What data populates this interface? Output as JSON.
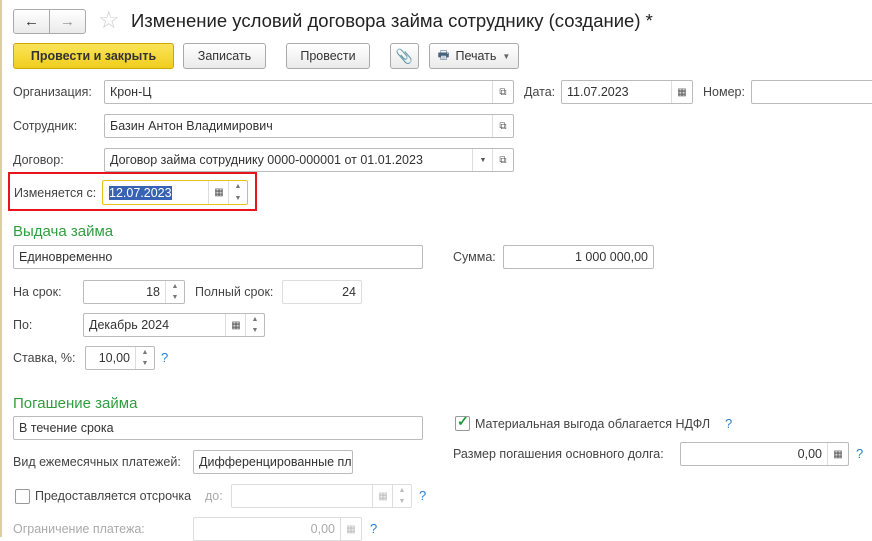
{
  "title": "Изменение условий договора займа сотруднику (создание) *",
  "toolbar": {
    "post_close": "Провести и закрыть",
    "save": "Записать",
    "post": "Провести",
    "print": "Печать"
  },
  "header": {
    "org_label": "Организация:",
    "org": "Крон-Ц",
    "date_label": "Дата:",
    "date": "11.07.2023",
    "number_label": "Номер:",
    "number": "",
    "employee_label": "Сотрудник:",
    "employee": "Базин Антон Владимирович",
    "contract_label": "Договор:",
    "contract": "Договор займа сотруднику 0000-000001 от 01.01.2023",
    "changes_label": "Изменяется с:",
    "changes": "12.07.2023"
  },
  "issue": {
    "heading": "Выдача займа",
    "type": "Единовременно",
    "sum_label": "Сумма:",
    "sum": "1 000 000,00",
    "term_label": "На срок:",
    "term": "18",
    "full_term_label": "Полный срок:",
    "full_term": "24",
    "until_label": "По:",
    "until": "Декабрь 2024",
    "rate_label": "Ставка, %:",
    "rate": "10,00",
    "help": "?"
  },
  "repay": {
    "heading": "Погашение займа",
    "type": "В течение срока",
    "benefit_label": "Материальная выгода облагается НДФЛ",
    "benefit_checked": true,
    "monthly_label": "Вид ежемесячных платежей:",
    "monthly": "Дифференцированные пл",
    "principal_label": "Размер погашения основного долга:",
    "principal": "0,00",
    "deferral_label": "Предоставляется отсрочка",
    "deferral_checked": false,
    "deferral_to_label": "до:",
    "deferral_to": "",
    "limit_label": "Ограничение платежа:",
    "limit": "0,00"
  }
}
